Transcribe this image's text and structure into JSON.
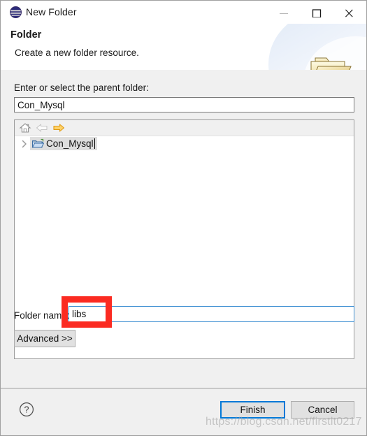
{
  "window": {
    "title": "New Folder",
    "app_icon": "eclipse-icon",
    "controls": {
      "minimize": "minimize-icon",
      "maximize": "maximize-icon",
      "close": "close-icon"
    }
  },
  "header": {
    "title": "Folder",
    "description": "Create a new folder resource.",
    "icon": "folder-open-large-icon"
  },
  "main": {
    "parent_label": "Enter or select the parent folder:",
    "parent_value": "Con_Mysql",
    "parent_placeholder": "",
    "tree": {
      "toolbar": [
        {
          "name": "home-icon",
          "enabled": false
        },
        {
          "name": "back-arrow-icon",
          "enabled": false
        },
        {
          "name": "forward-arrow-icon",
          "enabled": true
        }
      ],
      "rows": [
        {
          "label": "Con_Mysql",
          "icon": "folder-icon",
          "expanded": false,
          "selected": true
        }
      ]
    },
    "foldername_label": "Folder name:",
    "foldername_value": "libs",
    "foldername_placeholder": "",
    "advanced_label": "Advanced >>"
  },
  "footer": {
    "help_label": "?",
    "finish_label": "Finish",
    "cancel_label": "Cancel"
  },
  "annotations": {
    "highlight_color": "#fb2b22",
    "watermark": "https://blog.csdn.net/firstlt0217"
  },
  "colors": {
    "accent": "#0078d7",
    "dialog_bg": "#f0f0f0",
    "field_bg": "#ffffff",
    "selection_bg": "#dedede",
    "forward_arrow": "#f0a500"
  }
}
